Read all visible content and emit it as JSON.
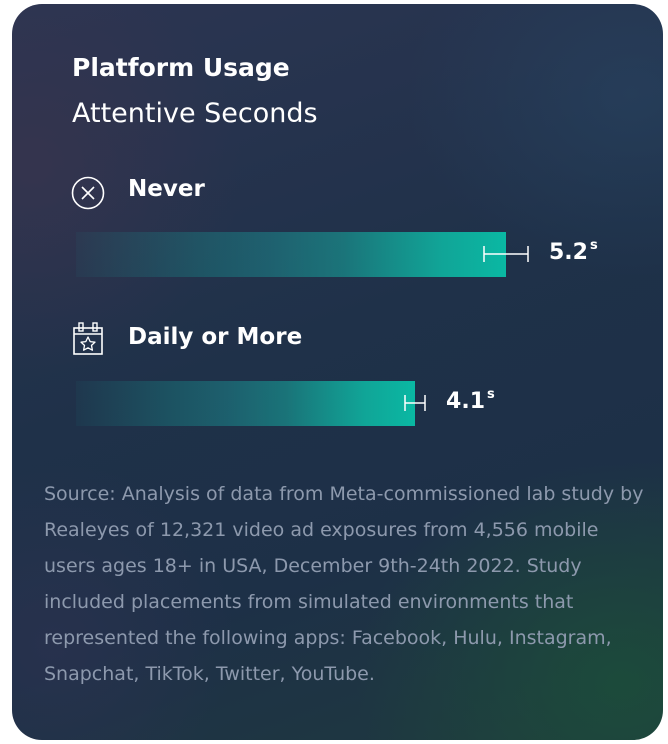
{
  "card": {
    "title": "Platform Usage",
    "subtitle": "Attentive Seconds"
  },
  "chart_data": {
    "type": "bar",
    "orientation": "horizontal",
    "title": "Platform Usage",
    "subtitle": "Attentive Seconds",
    "categories": [
      "Never",
      "Daily or More"
    ],
    "category_icons": [
      "close-circle-icon",
      "calendar-star-icon"
    ],
    "values": [
      5.2,
      4.1
    ],
    "value_labels": [
      "5.2",
      "4.1"
    ],
    "unit": "s",
    "error_bars": true,
    "xlim": [
      0,
      5.2
    ],
    "grid": false,
    "legend": "none"
  },
  "source": "Source: Analysis of data from Meta-commissioned lab study by Realeyes of 12,321 video ad exposures from 4,556 mobile users ages 18+ in USA, December 9th-24th 2022. Study included placements from simulated environments that represented the following apps: Facebook, Hulu, Instagram, Snapchat, TikTok, Twitter, YouTube.",
  "colors": {
    "bar": "#0ab8a3",
    "text": "#ffffff",
    "source_text": "#8d99ad"
  }
}
